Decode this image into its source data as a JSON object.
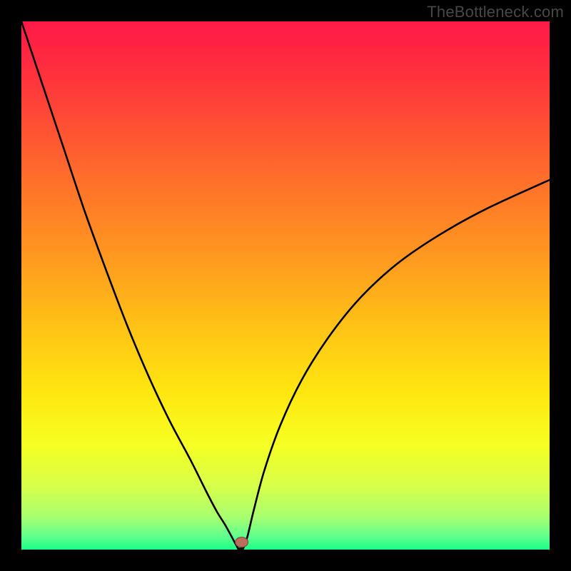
{
  "watermark": "TheBottleneck.com",
  "colors": {
    "frame": "#000000",
    "curve": "#000000",
    "marker_fill": "#bb6e5c",
    "marker_stroke": "#7a4034",
    "gradient_stops": [
      {
        "offset": 0.0,
        "color": "#ff1a46"
      },
      {
        "offset": 0.08,
        "color": "#ff2b40"
      },
      {
        "offset": 0.18,
        "color": "#ff4a35"
      },
      {
        "offset": 0.3,
        "color": "#ff6f2a"
      },
      {
        "offset": 0.45,
        "color": "#ff9a1f"
      },
      {
        "offset": 0.58,
        "color": "#ffc316"
      },
      {
        "offset": 0.7,
        "color": "#ffe60f"
      },
      {
        "offset": 0.8,
        "color": "#f6ff22"
      },
      {
        "offset": 0.88,
        "color": "#d7ff4a"
      },
      {
        "offset": 0.94,
        "color": "#a6ff70"
      },
      {
        "offset": 0.975,
        "color": "#5fff8e"
      },
      {
        "offset": 1.0,
        "color": "#1aff87"
      }
    ]
  },
  "chart_data": {
    "type": "line",
    "title": "",
    "xlabel": "",
    "ylabel": "",
    "xlim": [
      0,
      100
    ],
    "ylim": [
      0,
      100
    ],
    "left_branch": {
      "x": [
        0,
        4,
        8,
        12,
        16,
        20,
        24,
        28,
        32,
        35,
        37,
        38.5,
        39.5,
        40.2,
        40.7,
        41
      ],
      "y": [
        100,
        88,
        76,
        64,
        53,
        42.5,
        33,
        24.5,
        17,
        11,
        7.2,
        4.8,
        3.0,
        1.7,
        0.8,
        0.2
      ]
    },
    "right_branch": {
      "x": [
        42,
        42.8,
        44,
        46,
        49,
        53,
        58,
        64,
        71,
        79,
        88,
        100
      ],
      "y": [
        0.2,
        2.5,
        7.5,
        15,
        23.5,
        32,
        40,
        47.5,
        54,
        59.5,
        64.5,
        70
      ]
    },
    "floor": {
      "x": [
        41,
        42
      ],
      "y": [
        0.2,
        0.2
      ]
    },
    "marker": {
      "x": 41.7,
      "y": 1.4
    },
    "interpretation": "V-shaped bottleneck curve; minimum near x≈41–42 where bottleneck approaches 0%."
  }
}
